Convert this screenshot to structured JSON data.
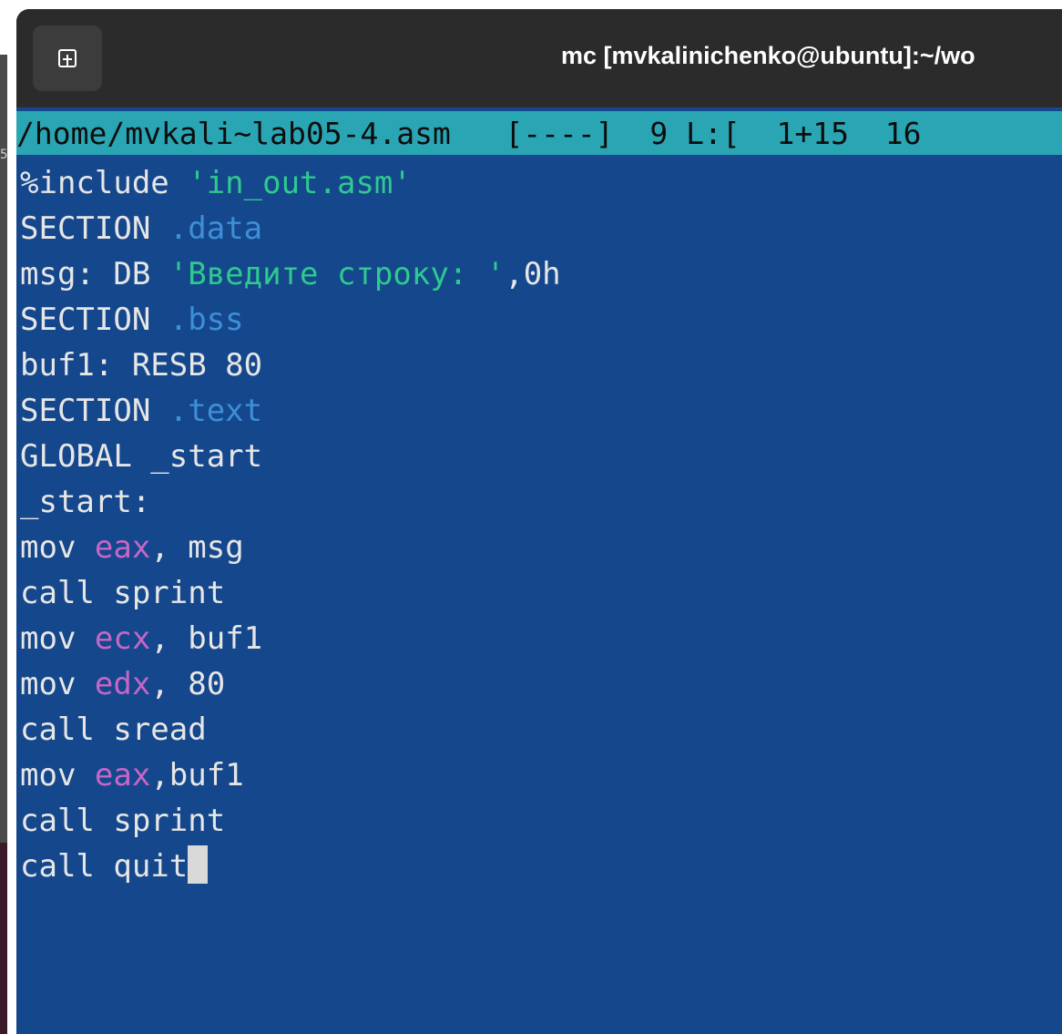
{
  "window": {
    "title": "mc [mvkalinichenko@ubuntu]:~/wo",
    "new_tab_icon": "new-tab-icon"
  },
  "desktop": {
    "edge_glyph": "5"
  },
  "editor": {
    "status": {
      "path": "/home/mvkali~lab05-4.asm",
      "flags": "[----]",
      "column": "9",
      "line_label": "L:[",
      "line_pos": "1+15",
      "total": "16"
    },
    "lines": [
      [
        {
          "t": "%include ",
          "c": "plain"
        },
        {
          "t": "'in_out.asm'",
          "c": "str"
        }
      ],
      [
        {
          "t": "SECTION ",
          "c": "plain"
        },
        {
          "t": ".data",
          "c": "sec"
        }
      ],
      [
        {
          "t": "msg: DB ",
          "c": "plain"
        },
        {
          "t": "'Введите строку: '",
          "c": "str"
        },
        {
          "t": ",0h",
          "c": "plain"
        }
      ],
      [
        {
          "t": "SECTION ",
          "c": "plain"
        },
        {
          "t": ".bss",
          "c": "sec"
        }
      ],
      [
        {
          "t": "buf1: RESB 80",
          "c": "plain"
        }
      ],
      [
        {
          "t": "SECTION ",
          "c": "plain"
        },
        {
          "t": ".text",
          "c": "sec"
        }
      ],
      [
        {
          "t": "GLOBAL _start",
          "c": "plain"
        }
      ],
      [
        {
          "t": "_start:",
          "c": "plain"
        }
      ],
      [
        {
          "t": "mov ",
          "c": "plain"
        },
        {
          "t": "eax",
          "c": "reg"
        },
        {
          "t": ", msg",
          "c": "plain"
        }
      ],
      [
        {
          "t": "call sprint",
          "c": "plain"
        }
      ],
      [
        {
          "t": "mov ",
          "c": "plain"
        },
        {
          "t": "ecx",
          "c": "reg"
        },
        {
          "t": ", buf1",
          "c": "plain"
        }
      ],
      [
        {
          "t": "mov ",
          "c": "plain"
        },
        {
          "t": "edx",
          "c": "reg"
        },
        {
          "t": ", 80",
          "c": "plain"
        }
      ],
      [
        {
          "t": "call sread",
          "c": "plain"
        }
      ],
      [
        {
          "t": "mov ",
          "c": "plain"
        },
        {
          "t": "eax",
          "c": "reg"
        },
        {
          "t": ",buf1",
          "c": "plain"
        }
      ],
      [
        {
          "t": "call sprint",
          "c": "plain"
        }
      ],
      [
        {
          "t": "call quit",
          "c": "plain"
        }
      ]
    ]
  }
}
